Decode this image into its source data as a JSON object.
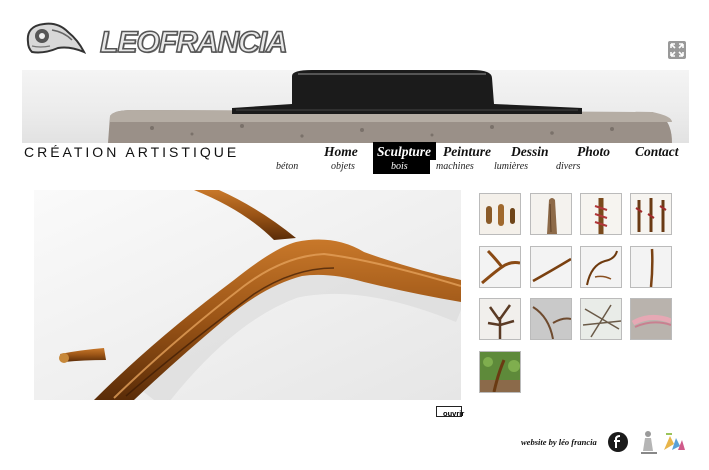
{
  "brand": {
    "logo_text": "LEOFRANCIA",
    "tagline": "CRÉATION ARTISTIQUE"
  },
  "nav": {
    "items": [
      {
        "label": "Home",
        "active": false
      },
      {
        "label": "Sculpture",
        "active": true
      },
      {
        "label": "Peinture",
        "active": false
      },
      {
        "label": "Dessin",
        "active": false
      },
      {
        "label": "Photo",
        "active": false
      },
      {
        "label": "Contact",
        "active": false
      }
    ]
  },
  "subnav": {
    "items": [
      {
        "label": "béton",
        "active": false
      },
      {
        "label": "objets",
        "active": false
      },
      {
        "label": "bois",
        "active": true
      },
      {
        "label": "machines",
        "active": false
      },
      {
        "label": "lumières",
        "active": false
      },
      {
        "label": "divers",
        "active": false
      }
    ]
  },
  "viewer": {
    "open_label": "ouvrir"
  },
  "thumbnails": [
    {
      "icon": "wood-pieces-thumbnail"
    },
    {
      "icon": "wood-stump-thumbnail"
    },
    {
      "icon": "wrapped-branch-thumbnail"
    },
    {
      "icon": "wrapped-sticks-thumbnail"
    },
    {
      "icon": "forked-branch-thumbnail"
    },
    {
      "icon": "long-branch-thumbnail"
    },
    {
      "icon": "curved-branch-thumbnail"
    },
    {
      "icon": "thin-stick-thumbnail"
    },
    {
      "icon": "root-sculpture-thumbnail"
    },
    {
      "icon": "bent-branch-thumbnail"
    },
    {
      "icon": "twig-wall-thumbnail"
    },
    {
      "icon": "pink-branch-thumbnail"
    },
    {
      "icon": "garden-branch-thumbnail"
    }
  ],
  "footer": {
    "credit": "website by léo francia"
  },
  "colors": {
    "accent": "#000000",
    "wood": "#8a4a14",
    "background": "#ffffff"
  }
}
